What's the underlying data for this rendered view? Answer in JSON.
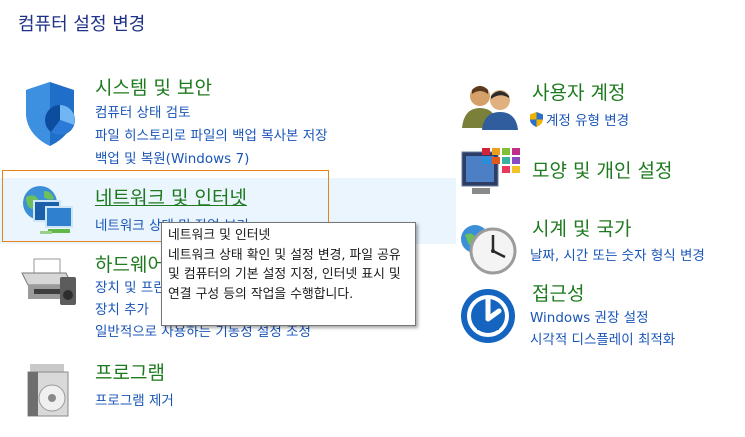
{
  "page": {
    "title": "컴퓨터 설정 변경"
  },
  "categories": {
    "system": {
      "title": "시스템 및 보안",
      "links": [
        "컴퓨터 상태 검토",
        "파일 히스토리로 파일의 백업 복사본 저장",
        "백업 및 복원(Windows 7)"
      ],
      "icon": "shield-pie-icon"
    },
    "network": {
      "title": "네트워크 및 인터넷",
      "links": [
        "네트워크 상태 및 작업 보기"
      ],
      "icon": "globe-network-icon"
    },
    "hardware": {
      "title": "하드웨어 및 소리",
      "links": [
        "장치 및 프린터 보기",
        "장치 추가",
        "일반적으로 사용하는 기동성 설정 조정"
      ],
      "icon": "printer-icon"
    },
    "programs": {
      "title": "프로그램",
      "links": [
        "프로그램 제거"
      ],
      "icon": "programs-disc-icon"
    },
    "accounts": {
      "title": "사용자 계정",
      "links": [
        "계정 유형 변경"
      ],
      "icon": "users-icon"
    },
    "appearance": {
      "title": "모양 및 개인 설정",
      "links": [],
      "icon": "monitor-tiles-icon"
    },
    "clock": {
      "title": "시계 및 국가",
      "links": [
        "날짜, 시간 또는 숫자 형식 변경"
      ],
      "icon": "clock-globe-icon"
    },
    "ease": {
      "title": "접근성",
      "links": [
        "Windows 권장 설정",
        "시각적 디스플레이 최적화"
      ],
      "icon": "ease-of-access-icon"
    }
  },
  "tooltip": {
    "title": "네트워크 및 인터넷",
    "body": "네트워크 상태 확인 및 설정 변경, 파일 공유 및 컴퓨터의 기본 설정 지정, 인터넷 표시 및 연결 구성 등의 작업을 수행합니다."
  },
  "colors": {
    "title_green": "#1e7a1e",
    "link_blue": "#1a56b8",
    "header_blue": "#1e3287",
    "highlight_border": "#e8831b",
    "highlight_bg": "#eaf5fd"
  }
}
